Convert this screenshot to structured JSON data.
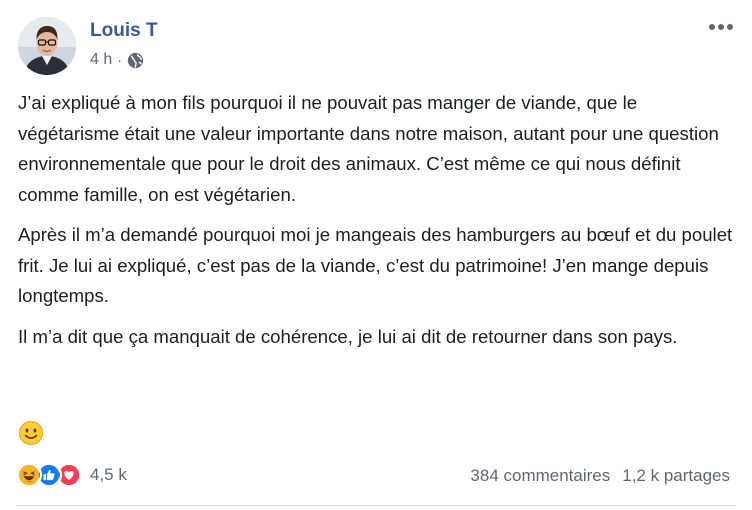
{
  "post": {
    "author": "Louis T",
    "time": "4 h",
    "separator": "·",
    "privacy_icon": "globe-icon",
    "more_icon": "more-options-icon",
    "paragraphs": [
      "J’ai expliqué à mon fils pourquoi il ne pouvait pas manger de viande, que le végétarisme était une valeur importante dans notre maison, autant pour une question environnementale que pour le droit des animaux. C’est même ce qui nous définit comme famille, on est végétarien.",
      "Après il m’a demandé pourquoi moi je mangeais des hamburgers au bœuf et du poulet frit. Je lui ai expliqué, c’est pas de la viande, c’est du patrimoine! J’en mange depuis longtemps.",
      "Il m’a dit que ça manquait de cohérence, je lui ai dit de retourner dans son pays."
    ],
    "emoji": "slightly-smiling-face"
  },
  "reactions": {
    "icons": [
      "haha-icon",
      "like-icon",
      "love-icon"
    ],
    "count": "4,5 k"
  },
  "stats": {
    "comments": "384 commentaires",
    "shares": "1,2 k partages"
  },
  "colors": {
    "author": "#385898",
    "meta": "#606770",
    "like": "#1877f2",
    "love": "#f33e58",
    "haha": "#f7b125"
  }
}
